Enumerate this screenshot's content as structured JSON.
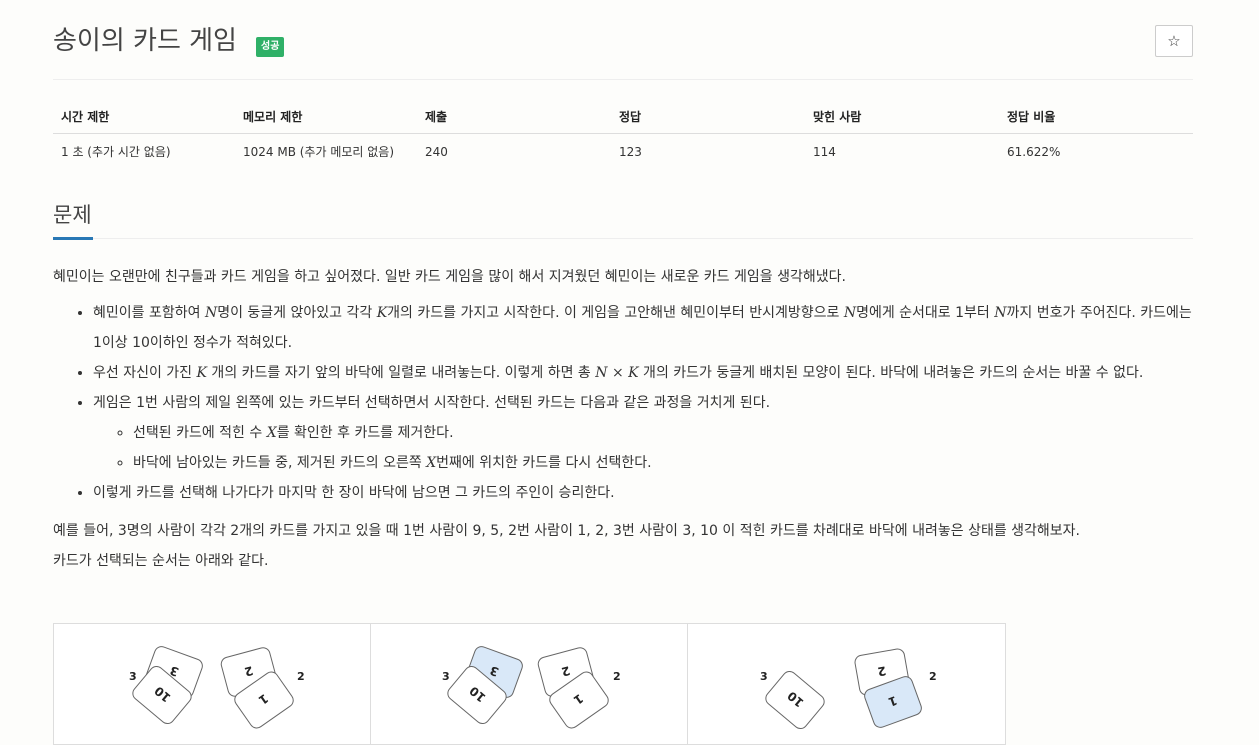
{
  "header": {
    "title": "송이의 카드 게임",
    "badge": "성공",
    "star_icon": "☆"
  },
  "info_table": {
    "columns": [
      "시간 제한",
      "메모리 제한",
      "제출",
      "정답",
      "맞힌 사람",
      "정답 비율"
    ],
    "values": [
      "1 초 (추가 시간 없음)",
      "1024 MB (추가 메모리 없음)",
      "240",
      "123",
      "114",
      "61.622%"
    ]
  },
  "section": {
    "title": "문제"
  },
  "problem": {
    "intro": "혜민이는 오랜만에 친구들과 카드 게임을 하고 싶어졌다. 일반 카드 게임을 많이 해서 지겨웠던 혜민이는 새로운 카드 게임을 생각해냈다.",
    "b1": {
      "t1": "혜민이를 포함하여 ",
      "m1": "N",
      "t2": "명이 둥글게 앉아있고 각각 ",
      "m2": "K",
      "t3": "개의 카드를 가지고 시작한다. 이 게임을 고안해낸 혜민이부터 반시계방향으로 ",
      "m3": "N",
      "t4": "명에게 순서대로 1부터 ",
      "m4": "N",
      "t5": "까지 번호가 주어진다. 카드에는 1이상 10이하인 정수가 적혀있다."
    },
    "b2": {
      "t1": "우선 자신이 가진 ",
      "m1": "K",
      "t2": " 개의 카드를 자기 앞의 바닥에 일렬로 내려놓는다. 이렇게 하면 총 ",
      "m2": "N × K",
      "t3": " 개의 카드가 둥글게 배치된 모양이 된다. 바닥에 내려놓은 카드의 순서는 바꿀 수 없다."
    },
    "b3": "게임은 1번 사람의 제일 왼쪽에 있는 카드부터 선택하면서 시작한다. 선택된 카드는 다음과 같은 과정을 거치게 된다.",
    "s1": {
      "t1": "선택된 카드에 적힌 수 ",
      "m1": "X",
      "t2": "를 확인한 후 카드를 제거한다."
    },
    "s2": {
      "t1": "바닥에 남아있는 카드들 중, 제거된 카드의 오른쪽 ",
      "m1": "X",
      "t2": "번째에 위치한 카드를 다시 선택한다."
    },
    "b4": "이렇게 카드를 선택해 나가다가 마지막 한 장이 바닥에 남으면 그 카드의 주인이 승리한다.",
    "example1": "예를 들어, 3명의 사람이 각각 2개의 카드를 가지고 있을 때 1번 사람이 9, 5, 2번 사람이 1, 2, 3번 사람이 3, 10 이 적힌 카드를 차례대로 바닥에 내려놓은 상태를 생각해보자.",
    "example2": "카드가 선택되는 순서는 아래와 같다."
  },
  "figures": [
    {
      "player_labels": [
        "3",
        "2"
      ],
      "cards": [
        "3",
        "10",
        "2",
        "1"
      ],
      "highlight": []
    },
    {
      "player_labels": [
        "3",
        "2"
      ],
      "cards": [
        "3",
        "10",
        "2",
        "1"
      ],
      "highlight": [
        "3"
      ]
    },
    {
      "player_labels": [
        "3",
        "2"
      ],
      "cards": [
        "10",
        "2",
        "1"
      ],
      "highlight": [
        "1"
      ]
    }
  ],
  "colors": {
    "badge": "#2fb067",
    "underline": "#2978b5",
    "card_highlight": "#d9e8f8"
  }
}
